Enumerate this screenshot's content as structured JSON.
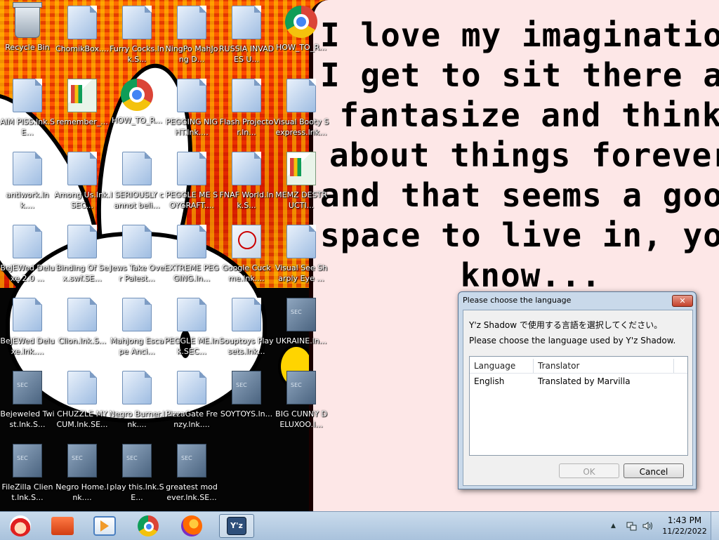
{
  "wallpaper": {
    "text": "I love my imagination\nI get to sit there and\nfantasize and think\nabout things forever\nand that seems a good\nspace to live in, you\nknow..."
  },
  "desktop": {
    "icons": [
      {
        "label": "Recycle Bin",
        "icon": "recycle-bin-icon"
      },
      {
        "label": "ChomikBox....",
        "icon": "shortcut-file-icon"
      },
      {
        "label": "Furry Cocks.lnk.S...",
        "icon": "shortcut-file-icon"
      },
      {
        "label": "NingPo MahJong D...",
        "icon": "shortcut-file-icon"
      },
      {
        "label": "RUSSIA INVADES U...",
        "icon": "shortcut-file-icon"
      },
      {
        "label": "HOW_TO_R...",
        "icon": "chrome-icon"
      },
      {
        "label": "AIM PISS.lnk.SE...",
        "icon": "shortcut-file-icon"
      },
      {
        "label": "remember_...",
        "icon": "google-doc-icon"
      },
      {
        "label": "HOW_TO_R...",
        "icon": "chrome-icon"
      },
      {
        "label": "PEGGING NIGHT.lnk....",
        "icon": "shortcut-file-icon"
      },
      {
        "label": "Flash Projector.ln...",
        "icon": "shortcut-file-icon"
      },
      {
        "label": "Visual Booty Sexpress.lnk...",
        "icon": "shortcut-file-icon"
      },
      {
        "label": "antiwork.lnk....",
        "icon": "shortcut-file-icon"
      },
      {
        "label": "Among Us.lnk.SEC...",
        "icon": "shortcut-file-icon"
      },
      {
        "label": "I SERIOUSLY cannot beli...",
        "icon": "shortcut-file-icon"
      },
      {
        "label": "PEGGLE ME SOYGRAFT....",
        "icon": "shortcut-file-icon"
      },
      {
        "label": "FNAF World.lnk.S...",
        "icon": "shortcut-file-icon"
      },
      {
        "label": "MEMZ DESTRUCTI...",
        "icon": "google-doc-icon"
      },
      {
        "label": "BeJEWed Deluxe 2.0 ...",
        "icon": "shortcut-file-icon"
      },
      {
        "label": "Binding Of Sex.swf.SE...",
        "icon": "shortcut-file-icon"
      },
      {
        "label": "Jews Take Over Palest...",
        "icon": "shortcut-file-icon"
      },
      {
        "label": "EXTREME PEGGING.ln...",
        "icon": "shortcut-file-icon"
      },
      {
        "label": "Google Cuckme.lnk....",
        "icon": "pdf-file-icon"
      },
      {
        "label": "Visual See Sharply Eye ...",
        "icon": "shortcut-file-icon"
      },
      {
        "label": "BeJEWed Deluxe.lnk....",
        "icon": "shortcut-file-icon"
      },
      {
        "label": "Clion.lnk.S...",
        "icon": "shortcut-file-icon"
      },
      {
        "label": "Mahjong Escape Anci...",
        "icon": "shortcut-file-icon"
      },
      {
        "label": "PEGGLE ME.lnk.SEC...",
        "icon": "shortcut-file-icon"
      },
      {
        "label": "Souptoys Playsets.lnk...",
        "icon": "shortcut-file-icon"
      },
      {
        "label": "UKRAINE.ln...",
        "icon": "sec-file-icon"
      },
      {
        "label": "Bejeweled Twist.lnk.S...",
        "icon": "sec-file-icon"
      },
      {
        "label": "CHUZZLE MY CUM.lnk.SE...",
        "icon": "shortcut-file-icon"
      },
      {
        "label": "Negro Burner.lnk....",
        "icon": "shortcut-file-icon"
      },
      {
        "label": "PizzaGate Frenzy.lnk....",
        "icon": "shortcut-file-icon"
      },
      {
        "label": "SOYTOYS.ln...",
        "icon": "sec-file-icon"
      },
      {
        "label": "BIG CUNNY DELUXOO.l...",
        "icon": "sec-file-icon"
      },
      {
        "label": "FileZilla Client.lnk.S...",
        "icon": "sec-file-icon"
      },
      {
        "label": "Negro Home.lnk....",
        "icon": "sec-file-icon"
      },
      {
        "label": "play this.lnk.SE...",
        "icon": "sec-file-icon"
      },
      {
        "label": "greatest mod ever.lnk.SE...",
        "icon": "sec-file-icon"
      }
    ]
  },
  "dialog": {
    "title": "Please choose the language",
    "close_glyph": "✕",
    "message_jp": "Y'z Shadow で使用する言語を選択してください。",
    "message_en": "Please choose the language used by Y'z Shadow.",
    "columns": [
      "Language",
      "Translator"
    ],
    "rows": [
      {
        "language": "English",
        "translator": "Translated by Marvilla"
      }
    ],
    "ok_label": "OK",
    "cancel_label": "Cancel"
  },
  "taskbar": {
    "apps": [
      {
        "name": "start-button",
        "icon": "santa-icon",
        "active": false
      },
      {
        "name": "taskbar-folder",
        "icon": "folder-icon",
        "active": false
      },
      {
        "name": "taskbar-media-player",
        "icon": "media-player-icon",
        "active": false
      },
      {
        "name": "taskbar-chrome",
        "icon": "chrome-icon",
        "active": false
      },
      {
        "name": "taskbar-firefox",
        "icon": "firefox-icon",
        "active": false
      },
      {
        "name": "taskbar-yz-shadow",
        "icon": "yz-shadow-icon",
        "active": true,
        "text": "Y'z"
      }
    ],
    "tray": {
      "chevron": "▲",
      "time": "1:43 PM",
      "date": "11/22/2022"
    }
  }
}
